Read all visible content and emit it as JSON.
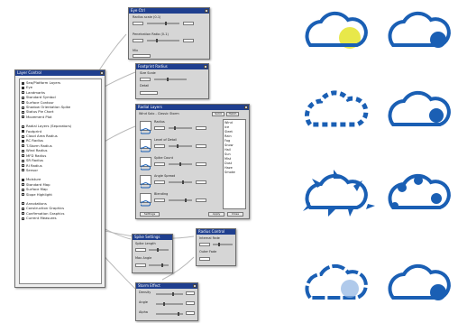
{
  "layer_control": {
    "title": "Layer Control",
    "items": [
      {
        "label": "Sea/Platform Layers",
        "checked": true
      },
      {
        "label": "Eye",
        "checked": true
      },
      {
        "label": "Landmarks",
        "checked": false
      },
      {
        "label": "Standard Symbol",
        "checked": false
      },
      {
        "label": "Surface Contour",
        "checked": false
      },
      {
        "label": "Shadow Orientation Spike",
        "checked": false
      },
      {
        "label": "Status Pie Chart",
        "checked": false
      },
      {
        "label": "Movement Plot",
        "checked": false
      },
      {
        "label": "",
        "checked": false
      },
      {
        "label": "Radial Layers (Separators)",
        "checked": false
      },
      {
        "label": "Footprint",
        "checked": true
      },
      {
        "label": "Cloud Area Radius",
        "checked": false
      },
      {
        "label": "RC Radius",
        "checked": true
      },
      {
        "label": "T-Storm Radius",
        "checked": false
      },
      {
        "label": "Wind Radius",
        "checked": false
      },
      {
        "label": "MFD Radius",
        "checked": false
      },
      {
        "label": "SR Radius",
        "checked": false
      },
      {
        "label": "RI Radius",
        "checked": false
      },
      {
        "label": "Sensor",
        "checked": false
      },
      {
        "label": "",
        "checked": false
      },
      {
        "label": "Moisture",
        "checked": true
      },
      {
        "label": "Standard Map",
        "checked": false
      },
      {
        "label": "Surface Map",
        "checked": false
      },
      {
        "label": "Slope Highlight",
        "checked": false
      },
      {
        "label": "",
        "checked": false
      },
      {
        "label": "Annotations",
        "checked": false
      },
      {
        "label": "Construction Graphics",
        "checked": false
      },
      {
        "label": "Confirmation Graphics",
        "checked": false
      },
      {
        "label": "Current Measures",
        "checked": false
      }
    ]
  },
  "panels": {
    "eye": {
      "title": "Eye Ctrl",
      "rows": [
        "Radius scale (0-1)",
        "Penetration Ratio (0-1)",
        "Mix"
      ],
      "button": "OK"
    },
    "footprint": {
      "title": "Footprint Radius",
      "rows": [
        "Size Scale",
        "Detail"
      ]
    },
    "main": {
      "title": "Radial Layers",
      "header": "Wind Solo - Classic Storm",
      "tabs": [
        "Solid",
        "Hatch"
      ],
      "rows": [
        "Radius",
        "Level of Detail",
        "Spike Count",
        "Angle Spread",
        "Blending"
      ],
      "list_items": [
        "Wind",
        "Ice",
        "Sleet",
        "Rain",
        "Fog",
        "Snow",
        "Hail",
        "Sun",
        "Mist",
        "Dust",
        "Haze",
        "Smoke"
      ],
      "buttons": [
        "Settings",
        "Apply",
        "Close"
      ]
    },
    "small_a": {
      "title": "Spike Settings",
      "rows": [
        "Spike Length",
        "Max Angle"
      ]
    },
    "small_b": {
      "title": "Radius Control",
      "rows": [
        "Internal Fade",
        "Outer Fade"
      ]
    },
    "bottom": {
      "title": "Storm Effect",
      "rows": [
        "Density",
        "Angle",
        "Alpha"
      ]
    }
  },
  "clouds": {
    "stroke_color": "#1a5fb4",
    "accent_color": "#e8e84a",
    "variants": [
      "cloud-eye-highlight-icon",
      "cloud-solid-icon",
      "cloud-dashed-icon",
      "cloud-solid-small-icon",
      "cloud-spiked-icon",
      "cloud-scalloped-icon",
      "cloud-fade-icon",
      "cloud-solid-large-icon"
    ]
  }
}
